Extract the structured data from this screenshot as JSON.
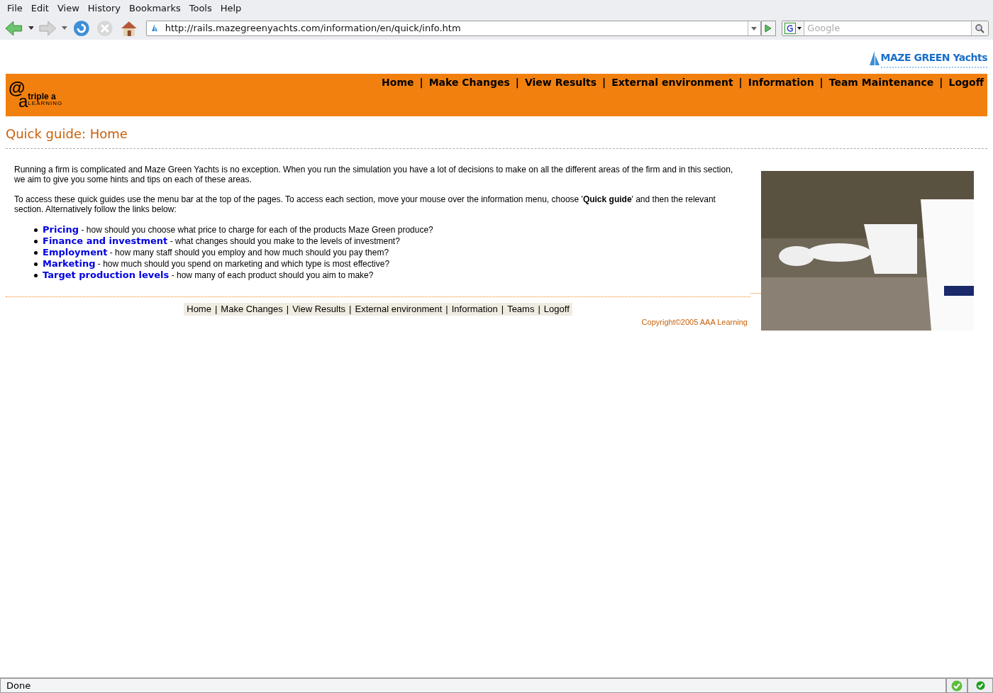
{
  "menu_bar": [
    "File",
    "Edit",
    "View",
    "History",
    "Bookmarks",
    "Tools",
    "Help"
  ],
  "toolbar": {
    "url": "http://rails.mazegreenyachts.com/information/en/quick/info.htm",
    "search_placeholder": "Google"
  },
  "brand_logo": {
    "text": "MAZE GREEN Yachts"
  },
  "header": {
    "logo": {
      "mark": "@",
      "letter": "a",
      "name": "triple a",
      "tagline": "LEARNING"
    },
    "separator": "|",
    "nav": [
      "Home",
      "Make Changes",
      "View Results",
      "External environment",
      "Information",
      "Team Maintenance",
      "Logoff"
    ]
  },
  "page_title": "Quick guide: Home",
  "paragraphs": [
    "Running a firm is complicated and Maze Green Yachts is no exception. When you run the simulation you have a lot of decisions to make on all the different areas of the firm and in this section, we aim to give you some hints and tips on each of these areas.",
    "To access these quick guides use the menu bar at the top of the pages. To access each section, move your mouse over the information menu, choose '**Quick guide**' and then the relevant section. Alternatively follow the links below:"
  ],
  "links": [
    {
      "label": "Pricing",
      "text": " - how should you choose what price to charge for each of the products Maze Green produce?"
    },
    {
      "label": "Finance and investment",
      "text": " - what changes should you make to the levels of investment?"
    },
    {
      "label": "Employment",
      "text": " - how many staff should you employ and how much should you pay them?"
    },
    {
      "label": "Marketing",
      "text": " - how much should you spend on marketing and which type is most effective?"
    },
    {
      "label": "Target production levels",
      "text": " - how many of each product should you aim to make?"
    }
  ],
  "footer_separator": "|",
  "footer_nav": [
    "Home",
    "Make Changes",
    "View Results",
    "External environment",
    "Information",
    "Teams",
    "Logoff"
  ],
  "copyright": "Copyright©2005 AAA Learning",
  "status_bar": {
    "text": "Done"
  }
}
